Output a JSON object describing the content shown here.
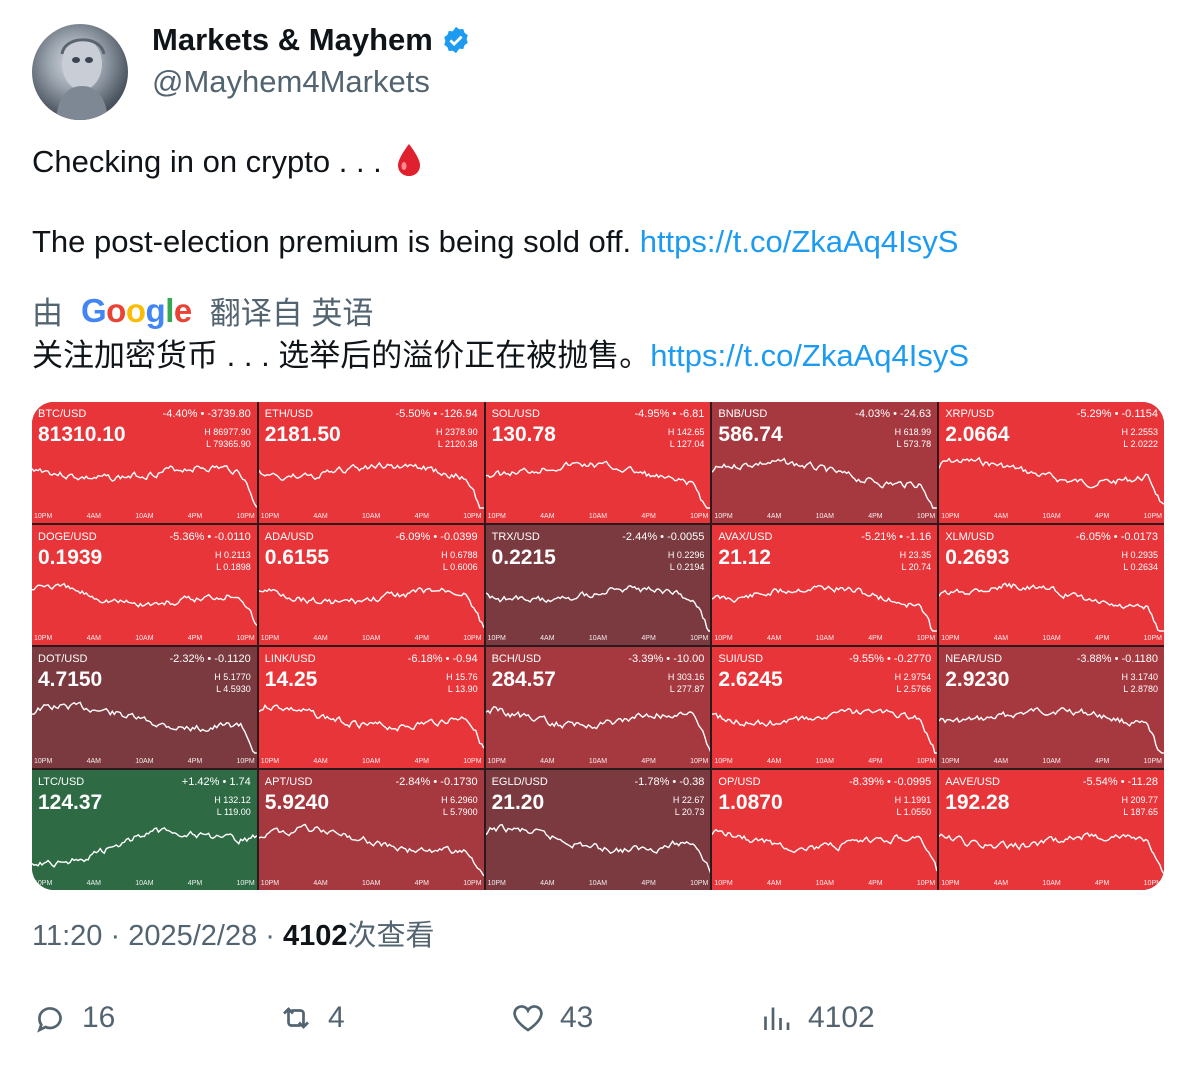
{
  "author": {
    "name": "Markets & Mayhem",
    "handle": "@Mayhem4Markets"
  },
  "tweet": {
    "line1": "Checking in on crypto . . .",
    "line2": "The post-election premium is being sold off.",
    "link": "https://t.co/ZkaAq4IsyS"
  },
  "translation": {
    "by": "由",
    "google": [
      "G",
      "o",
      "o",
      "g",
      "l",
      "e"
    ],
    "from": "翻译自 英语",
    "text": "关注加密货币 . . . 选举后的溢价正在被抛售。",
    "link": "https://t.co/ZkaAq4IsyS"
  },
  "colors": {
    "down_strong": "#e8353a",
    "down_muted": "#a6393f",
    "down_dark": "#7a3a40",
    "up": "#2e6b45",
    "link": "#1d9bf0"
  },
  "axis_labels": [
    "10PM",
    "4AM",
    "10AM",
    "4PM",
    "10PM"
  ],
  "tiles": [
    {
      "pair": "BTC/USD",
      "change": "-4.40% • -3739.80",
      "price": "81310.10",
      "high": "H 86977.90",
      "low": "L 79365.90",
      "tone": "down_strong"
    },
    {
      "pair": "ETH/USD",
      "change": "-5.50% • -126.94",
      "price": "2181.50",
      "high": "H 2378.90",
      "low": "L 2120.38",
      "tone": "down_strong"
    },
    {
      "pair": "SOL/USD",
      "change": "-4.95% • -6.81",
      "price": "130.78",
      "high": "H 142.65",
      "low": "L 127.04",
      "tone": "down_strong"
    },
    {
      "pair": "BNB/USD",
      "change": "-4.03% • -24.63",
      "price": "586.74",
      "high": "H 618.99",
      "low": "L 573.78",
      "tone": "down_muted"
    },
    {
      "pair": "XRP/USD",
      "change": "-5.29% • -0.1154",
      "price": "2.0664",
      "high": "H 2.2553",
      "low": "L 2.0222",
      "tone": "down_strong"
    },
    {
      "pair": "DOGE/USD",
      "change": "-5.36% • -0.0110",
      "price": "0.1939",
      "high": "H 0.2113",
      "low": "L 0.1898",
      "tone": "down_strong"
    },
    {
      "pair": "ADA/USD",
      "change": "-6.09% • -0.0399",
      "price": "0.6155",
      "high": "H 0.6788",
      "low": "L 0.6006",
      "tone": "down_strong"
    },
    {
      "pair": "TRX/USD",
      "change": "-2.44% • -0.0055",
      "price": "0.2215",
      "high": "H 0.2296",
      "low": "L 0.2194",
      "tone": "down_dark"
    },
    {
      "pair": "AVAX/USD",
      "change": "-5.21% • -1.16",
      "price": "21.12",
      "high": "H 23.35",
      "low": "L 20.74",
      "tone": "down_strong"
    },
    {
      "pair": "XLM/USD",
      "change": "-6.05% • -0.0173",
      "price": "0.2693",
      "high": "H 0.2935",
      "low": "L 0.2634",
      "tone": "down_strong"
    },
    {
      "pair": "DOT/USD",
      "change": "-2.32% • -0.1120",
      "price": "4.7150",
      "high": "H 5.1770",
      "low": "L 4.5930",
      "tone": "down_dark"
    },
    {
      "pair": "LINK/USD",
      "change": "-6.18% • -0.94",
      "price": "14.25",
      "high": "H 15.76",
      "low": "L 13.90",
      "tone": "down_strong"
    },
    {
      "pair": "BCH/USD",
      "change": "-3.39% • -10.00",
      "price": "284.57",
      "high": "H 303.16",
      "low": "L 277.87",
      "tone": "down_muted"
    },
    {
      "pair": "SUI/USD",
      "change": "-9.55% • -0.2770",
      "price": "2.6245",
      "high": "H 2.9754",
      "low": "L 2.5766",
      "tone": "down_strong"
    },
    {
      "pair": "NEAR/USD",
      "change": "-3.88% • -0.1180",
      "price": "2.9230",
      "high": "H 3.1740",
      "low": "L 2.8780",
      "tone": "down_muted"
    },
    {
      "pair": "LTC/USD",
      "change": "+1.42% • 1.74",
      "price": "124.37",
      "high": "H 132.12",
      "low": "L 119.00",
      "tone": "up"
    },
    {
      "pair": "APT/USD",
      "change": "-2.84% • -0.1730",
      "price": "5.9240",
      "high": "H 6.2960",
      "low": "L 5.7900",
      "tone": "down_muted"
    },
    {
      "pair": "EGLD/USD",
      "change": "-1.78% • -0.38",
      "price": "21.20",
      "high": "H 22.67",
      "low": "L 20.73",
      "tone": "down_dark"
    },
    {
      "pair": "OP/USD",
      "change": "-8.39% • -0.0995",
      "price": "1.0870",
      "high": "H 1.1991",
      "low": "L 1.0550",
      "tone": "down_strong"
    },
    {
      "pair": "AAVE/USD",
      "change": "-5.54% • -11.28",
      "price": "192.28",
      "high": "H 209.77",
      "low": "L 187.65",
      "tone": "down_strong"
    }
  ],
  "meta": {
    "time": "11:20",
    "date": "2025/2/28",
    "views": "4102",
    "views_label": "次查看"
  },
  "stats": {
    "replies": "16",
    "retweets": "4",
    "likes": "43",
    "views": "4102"
  }
}
